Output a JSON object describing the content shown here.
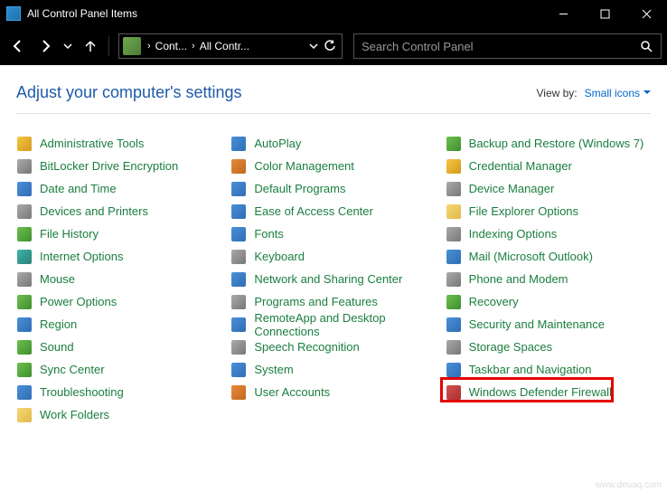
{
  "window": {
    "title": "All Control Panel Items"
  },
  "nav": {
    "crumb1": "Cont...",
    "crumb2": "All Contr...",
    "search_placeholder": "Search Control Panel"
  },
  "page": {
    "heading": "Adjust your computer's settings",
    "viewby_label": "View by:",
    "viewby_value": "Small icons"
  },
  "items": {
    "col1": [
      {
        "label": "Administrative Tools",
        "cls": "c-yellow"
      },
      {
        "label": "BitLocker Drive Encryption",
        "cls": "c-gray"
      },
      {
        "label": "Date and Time",
        "cls": "c-blue"
      },
      {
        "label": "Devices and Printers",
        "cls": "c-gray"
      },
      {
        "label": "File History",
        "cls": "c-green"
      },
      {
        "label": "Internet Options",
        "cls": "c-teal"
      },
      {
        "label": "Mouse",
        "cls": "c-gray"
      },
      {
        "label": "Power Options",
        "cls": "c-green"
      },
      {
        "label": "Region",
        "cls": "c-blue"
      },
      {
        "label": "Sound",
        "cls": "c-green"
      },
      {
        "label": "Sync Center",
        "cls": "c-green"
      },
      {
        "label": "Troubleshooting",
        "cls": "c-blue"
      },
      {
        "label": "Work Folders",
        "cls": "c-folder"
      }
    ],
    "col2": [
      {
        "label": "AutoPlay",
        "cls": "c-blue"
      },
      {
        "label": "Color Management",
        "cls": "c-orange"
      },
      {
        "label": "Default Programs",
        "cls": "c-blue"
      },
      {
        "label": "Ease of Access Center",
        "cls": "c-blue"
      },
      {
        "label": "Fonts",
        "cls": "c-blue"
      },
      {
        "label": "Keyboard",
        "cls": "c-gray"
      },
      {
        "label": "Network and Sharing Center",
        "cls": "c-blue"
      },
      {
        "label": "Programs and Features",
        "cls": "c-gray"
      },
      {
        "label": "RemoteApp and Desktop Connections",
        "cls": "c-blue"
      },
      {
        "label": "Speech Recognition",
        "cls": "c-gray"
      },
      {
        "label": "System",
        "cls": "c-blue"
      },
      {
        "label": "User Accounts",
        "cls": "c-orange"
      }
    ],
    "col3": [
      {
        "label": "Backup and Restore (Windows 7)",
        "cls": "c-green"
      },
      {
        "label": "Credential Manager",
        "cls": "c-yellow"
      },
      {
        "label": "Device Manager",
        "cls": "c-gray"
      },
      {
        "label": "File Explorer Options",
        "cls": "c-folder"
      },
      {
        "label": "Indexing Options",
        "cls": "c-gray"
      },
      {
        "label": "Mail (Microsoft Outlook)",
        "cls": "c-blue"
      },
      {
        "label": "Phone and Modem",
        "cls": "c-gray"
      },
      {
        "label": "Recovery",
        "cls": "c-green"
      },
      {
        "label": "Security and Maintenance",
        "cls": "c-blue"
      },
      {
        "label": "Storage Spaces",
        "cls": "c-gray"
      },
      {
        "label": "Taskbar and Navigation",
        "cls": "c-blue"
      },
      {
        "label": "Windows Defender Firewall",
        "cls": "c-red",
        "highlighted": true
      }
    ]
  },
  "footer": {
    "text": "www.deuaq.com"
  }
}
